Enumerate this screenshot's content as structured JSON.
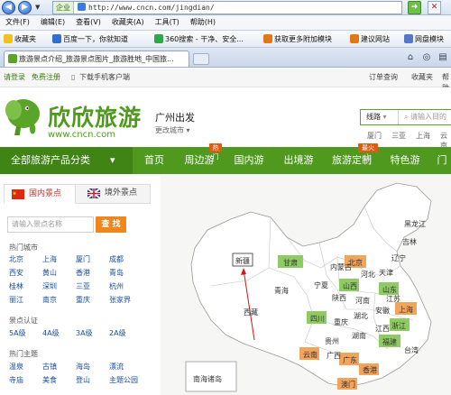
{
  "browser": {
    "enterprise_label": "企业",
    "address": "http://www.cncn.com/jingdian/",
    "menu": [
      "文件(F)",
      "编辑(E)",
      "查看(V)",
      "收藏夹(A)",
      "工具(T)",
      "帮助(H)"
    ],
    "favorites_label": "收藏夹",
    "favorites": [
      "百度一下，你就知道",
      "360搜索 - 干净、安全...",
      "获取更多附加模块",
      "建议网站",
      "网盘模块"
    ],
    "tab_title": "旅游景点介绍_旅游景点图片_旅游胜地_中国旅..."
  },
  "site": {
    "login": "请登录",
    "register": "免费注册",
    "mobile": "下载手机客户端",
    "order": "订单查询",
    "favorites": "收藏夹",
    "more": "帮助",
    "brand": "欣欣旅游",
    "brand_url": "www.cncn.com",
    "city": "广州出发",
    "city_switch": "更改城市",
    "search_type": "线路",
    "search_placeholder": "请输入目的",
    "hot_cities": [
      "厦门",
      "三亚",
      "上海",
      "云南"
    ],
    "nav_category": "全部旅游产品分类",
    "nav": [
      {
        "label": "首页",
        "badge": ""
      },
      {
        "label": "周边游",
        "badge": "热门"
      },
      {
        "label": "国内游",
        "badge": ""
      },
      {
        "label": "出境游",
        "badge": ""
      },
      {
        "label": "旅游定制",
        "badge": "最火上"
      },
      {
        "label": "特色游",
        "badge": ""
      },
      {
        "label": "门",
        "badge": ""
      }
    ]
  },
  "left": {
    "tab_domestic": "国内景点",
    "tab_abroad": "境外景点",
    "search_placeholder": "请输入景点名称",
    "search_button": "查 找",
    "hot_city_title": "热门城市",
    "hot_cities": [
      "北京",
      "上海",
      "厦门",
      "成都",
      "西安",
      "黄山",
      "香港",
      "青岛",
      "桂林",
      "深圳",
      "三亚",
      "杭州",
      "丽江",
      "南京",
      "重庆",
      "张家界"
    ],
    "rating_title": "景点认证",
    "ratings": [
      "5A级",
      "4A级",
      "3A级",
      "2A级"
    ],
    "theme_title": "热门主题",
    "themes": [
      "温泉",
      "古镇",
      "海岛",
      "漂流",
      "寺庙",
      "美食",
      "登山",
      "主题公园"
    ]
  },
  "map": {
    "provinces": [
      "黑龙江",
      "吉林",
      "辽宁",
      "内蒙古",
      "北京",
      "天津",
      "新疆",
      "甘肃",
      "宁夏",
      "山西",
      "河北",
      "山东",
      "青海",
      "陕西",
      "河南",
      "江苏",
      "西藏",
      "四川",
      "湖北",
      "安徽",
      "上海",
      "重庆",
      "浙江",
      "贵州",
      "湖南",
      "江西",
      "福建",
      "台湾",
      "云南",
      "广西",
      "广东",
      "香港",
      "澳门"
    ],
    "inset": "南海诸岛"
  }
}
